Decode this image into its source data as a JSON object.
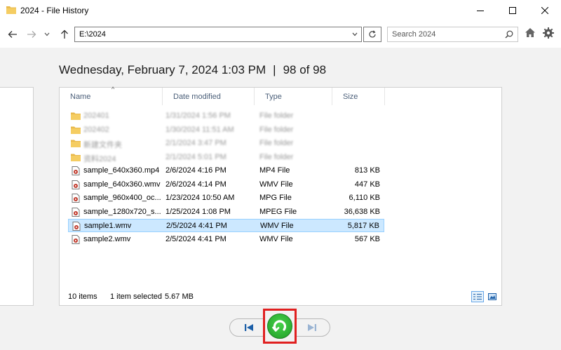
{
  "window": {
    "title": "2024 - File History"
  },
  "nav": {
    "address": "E:\\2024",
    "search_placeholder": "Search 2024"
  },
  "snapshot": {
    "datetime": "Wednesday, February 7, 2024 1:03 PM",
    "separator": "|",
    "position": "98 of 98"
  },
  "columns": {
    "name": "Name",
    "date": "Date modified",
    "type": "Type",
    "size": "Size"
  },
  "files": [
    {
      "name": "202401",
      "date": "1/31/2024 1:56 PM",
      "type": "File folder",
      "size": "",
      "kind": "folder",
      "blurred": true
    },
    {
      "name": "202402",
      "date": "1/30/2024 11:51 AM",
      "type": "File folder",
      "size": "",
      "kind": "folder",
      "blurred": true
    },
    {
      "name": "新建文件夹",
      "date": "2/1/2024 3:47 PM",
      "type": "File folder",
      "size": "",
      "kind": "folder",
      "blurred": true
    },
    {
      "name": "资料2024",
      "date": "2/1/2024 5:01 PM",
      "type": "File folder",
      "size": "",
      "kind": "folder",
      "blurred": true
    },
    {
      "name": "sample_640x360.mp4",
      "date": "2/6/2024 4:16 PM",
      "type": "MP4 File",
      "size": "813 KB",
      "kind": "video",
      "blurred": false
    },
    {
      "name": "sample_640x360.wmv",
      "date": "2/6/2024 4:14 PM",
      "type": "WMV File",
      "size": "447 KB",
      "kind": "video",
      "blurred": false
    },
    {
      "name": "sample_960x400_oc...",
      "date": "1/23/2024 10:50 AM",
      "type": "MPG File",
      "size": "6,110 KB",
      "kind": "video",
      "blurred": false
    },
    {
      "name": "sample_1280x720_s...",
      "date": "1/25/2024 1:08 PM",
      "type": "MPEG File",
      "size": "36,638 KB",
      "kind": "video",
      "blurred": false
    },
    {
      "name": "sample1.wmv",
      "date": "2/5/2024 4:41 PM",
      "type": "WMV File",
      "size": "5,817 KB",
      "kind": "video",
      "blurred": false,
      "selected": true
    },
    {
      "name": "sample2.wmv",
      "date": "2/5/2024 4:41 PM",
      "type": "WMV File",
      "size": "567 KB",
      "kind": "video",
      "blurred": false
    }
  ],
  "status": {
    "items": "10 items",
    "selected": "1 item selected",
    "size": "5.67 MB"
  },
  "icons": {
    "folder_color": "#e8b84a",
    "restore_color": "#2fb836",
    "highlight_color": "#e02020"
  }
}
